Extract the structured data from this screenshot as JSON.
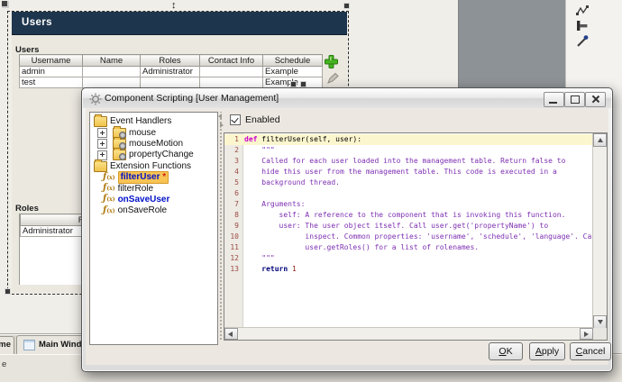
{
  "users_window": {
    "title": "Users",
    "users_section_label": "Users",
    "users_table": {
      "columns": [
        "Username",
        "Name",
        "Roles",
        "Contact Info",
        "Schedule"
      ],
      "rows": [
        [
          "admin",
          "",
          "Administrator",
          "",
          "Example"
        ],
        [
          "test",
          "",
          "",
          "",
          "Example"
        ]
      ]
    },
    "roles_section_label": "Roles",
    "roles_table": {
      "columns": [
        "Role Name"
      ],
      "rows": [
        [
          "Administrator"
        ]
      ]
    }
  },
  "designer": {
    "bottom_tabs": {
      "left_partial": "me",
      "main_window": "Main Window",
      "second_row_partial": "e"
    },
    "right_toolbar_icons": [
      "polyline-tool",
      "shape-tool",
      "eyedropper-tool"
    ]
  },
  "dialog": {
    "title": "Component Scripting [User Management]",
    "window_controls": [
      "minimize",
      "maximize",
      "close"
    ],
    "enabled_label": "Enabled",
    "enabled_checked": true,
    "tree": {
      "folders": [
        {
          "label": "Event Handlers",
          "children": [
            {
              "label": "mouse",
              "expandable": true
            },
            {
              "label": "mouseMotion",
              "expandable": true
            },
            {
              "label": "propertyChange",
              "expandable": true
            }
          ]
        },
        {
          "label": "Extension Functions",
          "children": [
            {
              "label": "filterUser",
              "suffix": " *",
              "selected": true,
              "modified": true
            },
            {
              "label": "filterRole"
            },
            {
              "label": "onSaveUser",
              "modified": true
            },
            {
              "label": "onSaveRole"
            }
          ]
        }
      ]
    },
    "code": {
      "lines": [
        {
          "n": 1,
          "hl": true,
          "seg": [
            {
              "t": "def",
              "c": "kw"
            },
            {
              "t": " filterUser(self, user):",
              "c": "pl"
            }
          ]
        },
        {
          "n": 2,
          "seg": [
            {
              "t": "    \"\"\"",
              "c": "doc"
            }
          ]
        },
        {
          "n": 3,
          "seg": [
            {
              "t": "    Called for each user loaded into the management table. Return false to",
              "c": "doc"
            }
          ]
        },
        {
          "n": 4,
          "seg": [
            {
              "t": "    hide this user from the management table. This code is executed in a",
              "c": "doc"
            }
          ]
        },
        {
          "n": 5,
          "seg": [
            {
              "t": "    background thread.",
              "c": "doc"
            }
          ]
        },
        {
          "n": 6,
          "seg": []
        },
        {
          "n": 7,
          "seg": [
            {
              "t": "    Arguments:",
              "c": "doc"
            }
          ]
        },
        {
          "n": 8,
          "seg": [
            {
              "t": "        self: A reference to the component that is invoking this function.",
              "c": "doc"
            }
          ]
        },
        {
          "n": 9,
          "seg": [
            {
              "t": "        user: The user object itself. Call user.get('propertyName') to",
              "c": "doc"
            }
          ]
        },
        {
          "n": 10,
          "seg": [
            {
              "t": "              inspect. Common properties: 'username', 'schedule', 'language'. Call",
              "c": "doc"
            }
          ]
        },
        {
          "n": 11,
          "seg": [
            {
              "t": "              user.getRoles() for a list of rolenames.",
              "c": "doc"
            }
          ]
        },
        {
          "n": 12,
          "seg": [
            {
              "t": "    \"\"\"",
              "c": "doc"
            }
          ]
        },
        {
          "n": 13,
          "seg": [
            {
              "t": "    ",
              "c": "pl"
            },
            {
              "t": "return",
              "c": "kw2"
            },
            {
              "t": " ",
              "c": "pl"
            },
            {
              "t": "1",
              "c": "num"
            }
          ]
        }
      ]
    },
    "buttons": [
      {
        "id": "ok-btn",
        "label": "OK"
      },
      {
        "id": "apply-btn",
        "label": "Apply"
      },
      {
        "id": "cancel-btn",
        "label": "Cancel"
      }
    ]
  },
  "colors": {
    "component_header": "#1e364d",
    "tree_selection": "#f8c455",
    "modified_function_text": "#0010c8",
    "dirty_star": "#d02010",
    "add_button_green": "#45b31f",
    "code_keyword_def": "#cc00cc",
    "code_keyword_return": "#00007a",
    "code_docstring": "#7d2fb2",
    "code_number": "#8b1a10",
    "code_line_number": "#9d4b45",
    "current_line_highlight": "#fcf6cf"
  }
}
